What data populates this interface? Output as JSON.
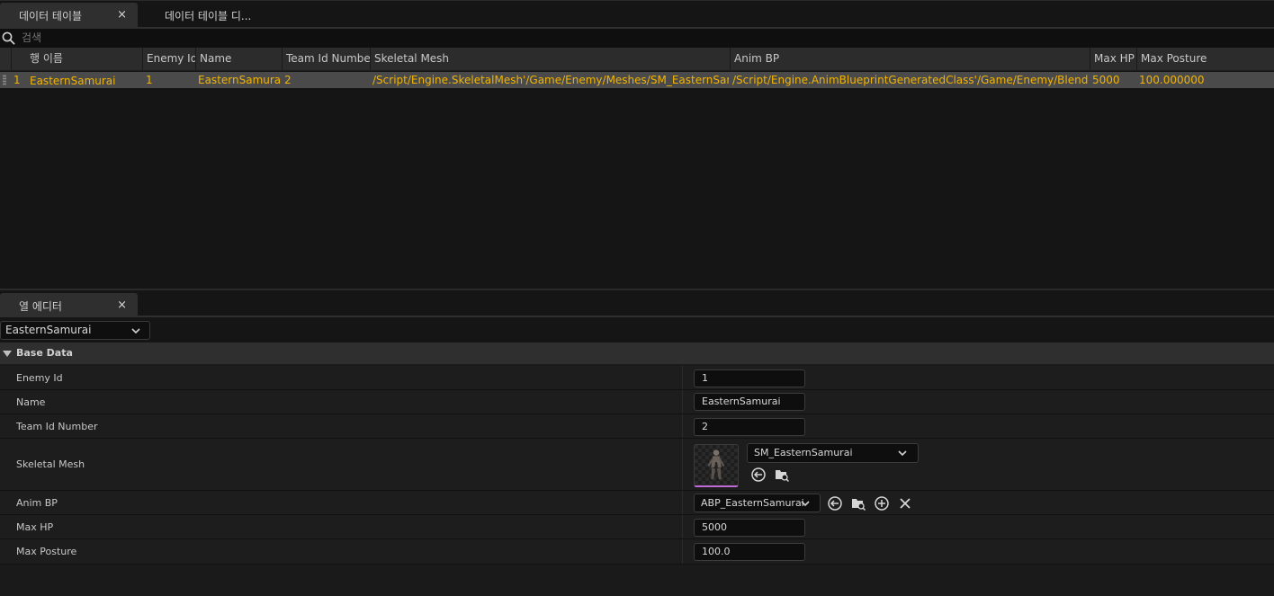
{
  "tabs": [
    {
      "label": "데이터 테이블",
      "active": true,
      "close": "×"
    },
    {
      "label": "데이터 테이블 디...",
      "active": false
    }
  ],
  "search": {
    "placeholder": "검색"
  },
  "table": {
    "columns": [
      "행 이름",
      "Enemy Id",
      "Name",
      "Team Id Number",
      "Skeletal Mesh",
      "Anim BP",
      "Max HP",
      "Max Posture"
    ],
    "rows": [
      {
        "index": "1",
        "row_name": "EasternSamurai",
        "enemy_id": "1",
        "name": "EasternSamurai",
        "team_id": "2",
        "skeletal_mesh": "/Script/Engine.SkeletalMesh'/Game/Enemy/Meshes/SM_EasternSamurai",
        "anim_bp": "/Script/Engine.AnimBlueprintGeneratedClass'/Game/Enemy/BlendSpace",
        "max_hp": "5000",
        "max_posture": "100.000000"
      }
    ]
  },
  "row_editor": {
    "tab_label": "열 에디터",
    "close": "×",
    "selected_row": "EasternSamurai",
    "category": "Base Data",
    "properties": {
      "enemy_id": {
        "label": "Enemy Id",
        "value": "1"
      },
      "name": {
        "label": "Name",
        "value": "EasternSamurai"
      },
      "team_id": {
        "label": "Team Id Number",
        "value": "2"
      },
      "skeletal_mesh": {
        "label": "Skeletal Mesh",
        "value": "SM_EasternSamurai"
      },
      "anim_bp": {
        "label": "Anim BP",
        "value": "ABP_EasternSamurai"
      },
      "max_hp": {
        "label": "Max HP",
        "value": "5000"
      },
      "max_posture": {
        "label": "Max Posture",
        "value": "100.0"
      }
    }
  },
  "colors": {
    "highlight_text": "#f2b400",
    "selected_row_bg": "#4a4a4a",
    "thumbnail_accent": "#c06ad8"
  }
}
